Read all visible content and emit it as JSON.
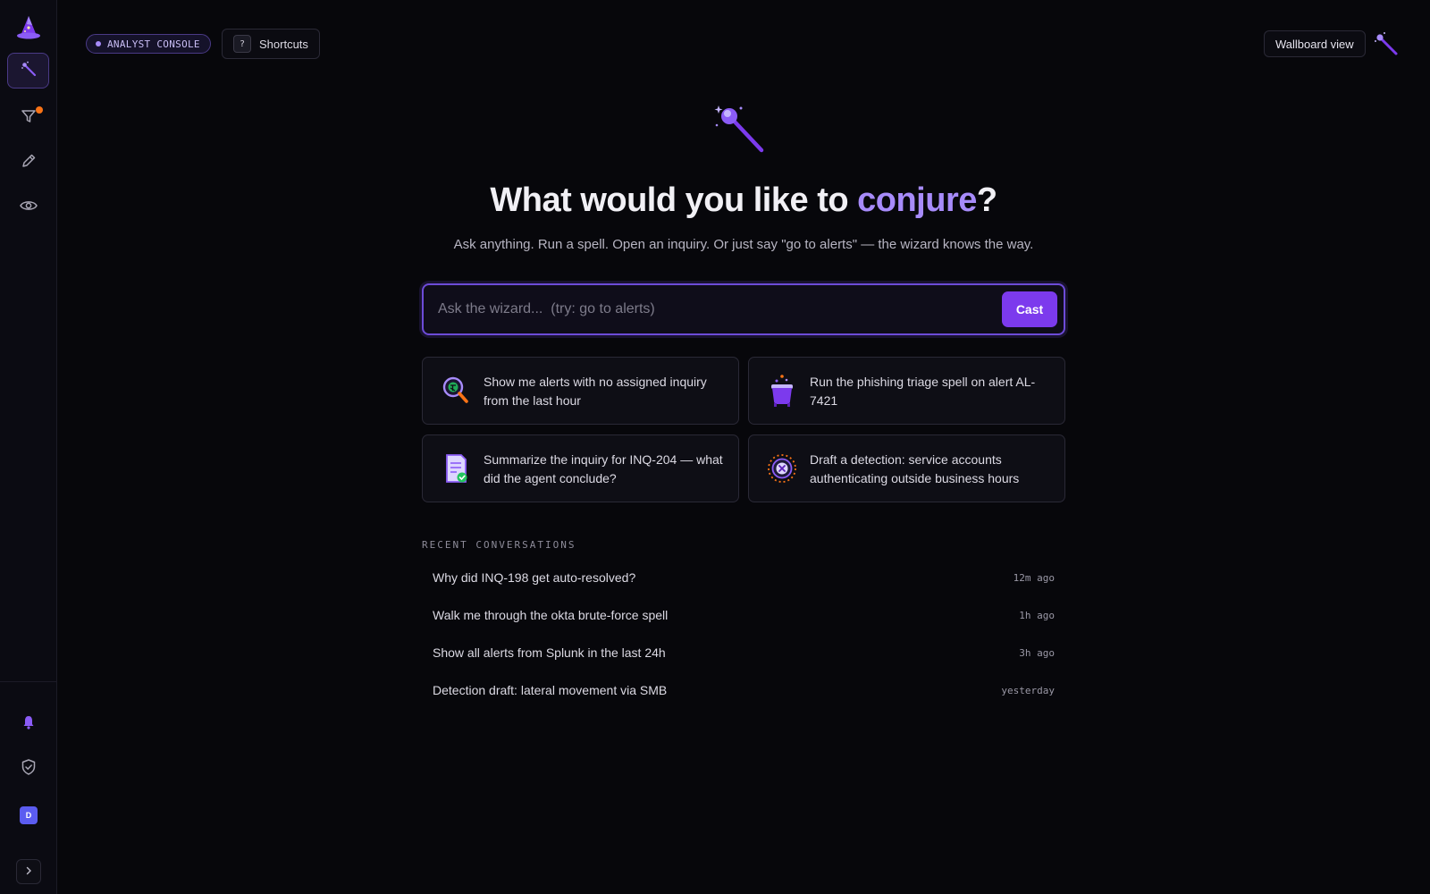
{
  "topbar": {
    "console_label": "ANALYST CONSOLE",
    "shortcuts_key": "?",
    "shortcuts_label": "Shortcuts",
    "wallboard_label": "Wallboard view"
  },
  "sidebar": {
    "avatar_initial": "D",
    "filter_badge_color": "#f97316"
  },
  "hero": {
    "headline_prefix": "What would you like to ",
    "headline_accent": "conjure",
    "headline_suffix": "?",
    "subline": "Ask anything. Run a spell. Open an inquiry. Or just say \"go to alerts\" — the wizard knows the way."
  },
  "search": {
    "placeholder": "Ask the wizard...  (try: go to alerts)",
    "value": "",
    "cast_label": "Cast"
  },
  "suggestions": [
    {
      "icon": "magnifier-icon",
      "text": "Show me alerts with no assigned inquiry from the last hour"
    },
    {
      "icon": "cauldron-icon",
      "text": "Run the phishing triage spell on alert AL-7421"
    },
    {
      "icon": "scroll-icon",
      "text": "Summarize the inquiry for INQ-204 — what did the agent conclude?"
    },
    {
      "icon": "rune-circle-icon",
      "text": "Draft a detection: service accounts authenticating outside business hours"
    }
  ],
  "recent": {
    "heading": "RECENT CONVERSATIONS",
    "items": [
      {
        "title": "Why did INQ-198 get auto-resolved?",
        "time": "12m ago"
      },
      {
        "title": "Walk me through the okta brute-force spell",
        "time": "1h ago"
      },
      {
        "title": "Show all alerts from Splunk in the last 24h",
        "time": "3h ago"
      },
      {
        "title": "Detection draft: lateral movement via SMB",
        "time": "yesterday"
      }
    ]
  },
  "colors": {
    "accent": "#a78bfa",
    "brand": "#7c3aed",
    "background": "#07070b"
  }
}
